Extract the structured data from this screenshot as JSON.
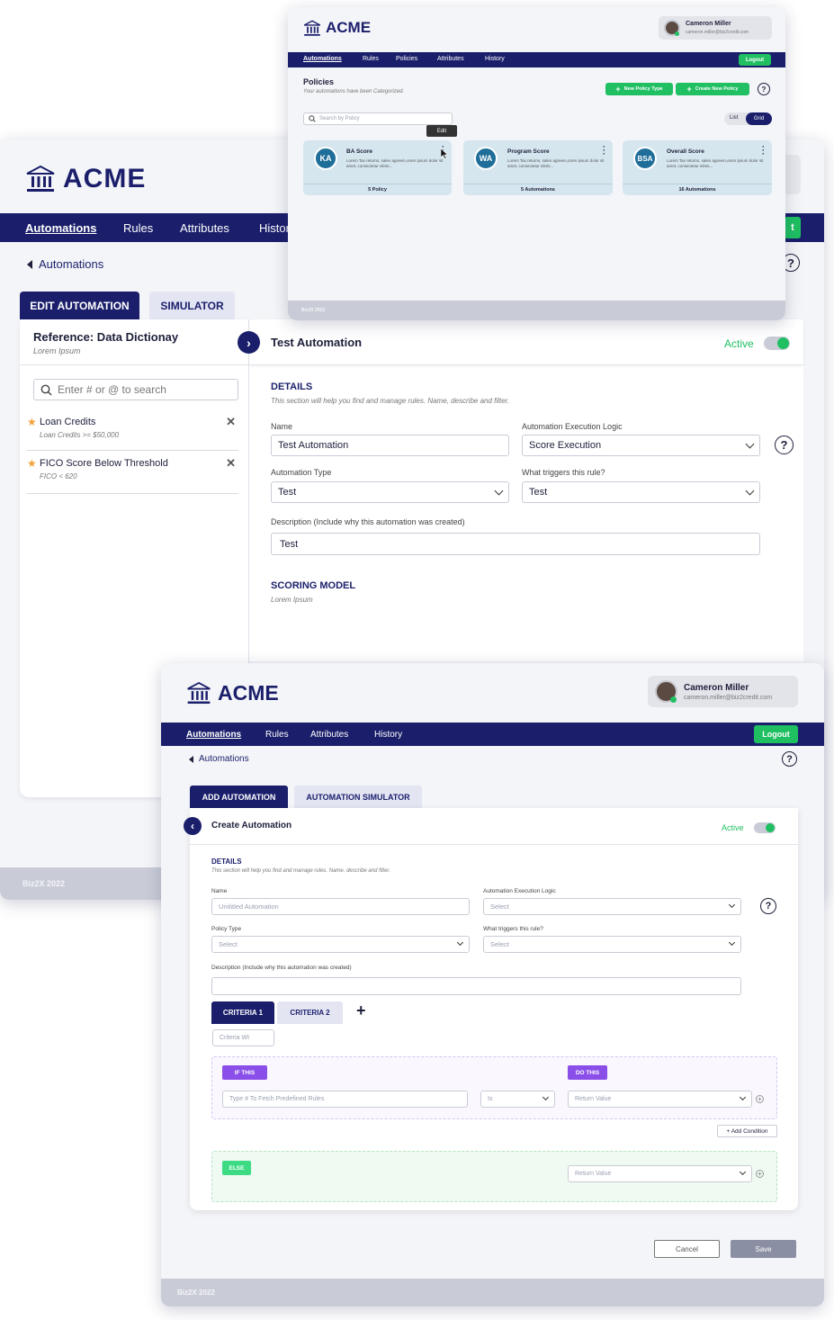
{
  "brand": "ACME",
  "back_screen": {
    "nav": [
      "Automations",
      "Rules",
      "Attributes",
      "Histor"
    ],
    "nav_partial_right": "t",
    "breadcrumb": "Automations",
    "tabs": [
      "EDIT AUTOMATION",
      "SIMULATOR"
    ],
    "reference": {
      "title": "Reference: Data Dictionay",
      "subtitle": "Lorem Ipsum",
      "search_placeholder": "Enter # or @ to search",
      "items": [
        {
          "name": "Loan Credits",
          "detail": "Loan Credits >= $50,000"
        },
        {
          "name": "FICO Score Below Threshold",
          "detail": "FICO < 620"
        }
      ]
    },
    "automation": {
      "title": "Test Automation",
      "status": "Active",
      "details_heading": "DETAILS",
      "details_sub": "This section will help you find and manage rules.  Name, describe and filter.",
      "name_label": "Name",
      "name_value": "Test Automation",
      "logic_label": "Automation Execution Logic",
      "logic_value": "Score Execution",
      "type_label": "Automation Type",
      "type_value": "Test",
      "trigger_label": "What triggers this rule?",
      "trigger_value": "Test",
      "desc_label": "Description (Include why this automation was created)",
      "desc_value": "Test",
      "scoring_heading": "SCORING MODEL",
      "scoring_sub": "Lorem Ipsum"
    },
    "footer": "Biz2X 2022"
  },
  "top_screen": {
    "user_name": "Cameron Miller",
    "user_email": "cameron.miller@biz2credit.com",
    "nav": [
      "Automations",
      "Rules",
      "Policies",
      "Attributes",
      "History"
    ],
    "logout": "Logout",
    "title": "Policies",
    "subtitle": "Your automations have been Categorized.",
    "new_policy_type": "New Policy Type",
    "create_new_policy": "Create New Policy",
    "search_placeholder": "Search by Policy",
    "view_list": "List",
    "view_grid": "Grid",
    "tooltip": "Edit",
    "cards": [
      {
        "initials": "KA",
        "name": "BA Score",
        "desc": "Lorem Tax returns, sales agreem,orem ipsum dolor sit amet, consectetur elints...",
        "footer": "5 Policy"
      },
      {
        "initials": "WA",
        "name": "Program Score",
        "desc": "Lorem Tax returns, sales agreem,orem ipsum dolor sit amet, consectetur elints...",
        "footer": "5 Automations"
      },
      {
        "initials": "BSA",
        "name": "Overall Score",
        "desc": "Lorem Tax returns, sales agreem,orem ipsum dolor sit amet, consectetur elints...",
        "footer": "16 Automations"
      }
    ],
    "footer": "Biz2X 2022"
  },
  "front_screen": {
    "user_name": "Cameron Miller",
    "user_email": "cameron.miller@biz2credit.com",
    "nav": [
      "Automations",
      "Rules",
      "Attributes",
      "History"
    ],
    "logout": "Logout",
    "breadcrumb": "Automations",
    "tabs": [
      "ADD AUTOMATION",
      "AUTOMATION SIMULATOR"
    ],
    "title": "Create Automation",
    "status": "Active",
    "details_heading": "DETAILS",
    "details_sub": "This section will help you find and manage rules.  Name, describe and filter.",
    "name_label": "Name",
    "name_placeholder": "Unititled Automation",
    "logic_label": "Automation Execution Logic",
    "logic_value": "Select",
    "policy_type_label": "Policy Type",
    "policy_type_value": "Select",
    "trigger_label": "What triggers this rule?",
    "trigger_value": "Select",
    "desc_label": "Description (Include why this automation was created)",
    "criteria_tabs": [
      "CRITERIA 1",
      "CRITERIA 2"
    ],
    "criteria_wt_placeholder": "Criteria Wt",
    "if_label": "IF THIS",
    "do_label": "DO THIS",
    "rule_placeholder": "Type # To Fetch Predefined Rules",
    "operator_value": "Is",
    "return_value": "Return Value",
    "add_condition": "+ Add Condition",
    "else_label": "ELSE",
    "else_return_value": "Return Value",
    "cancel": "Cancel",
    "save": "Save",
    "footer": "Biz2X 2022"
  },
  "colors": {
    "navy": "#1b1f6b",
    "green": "#1fbf62",
    "purple": "#8a4fe8",
    "teal": "#1f6e99"
  }
}
